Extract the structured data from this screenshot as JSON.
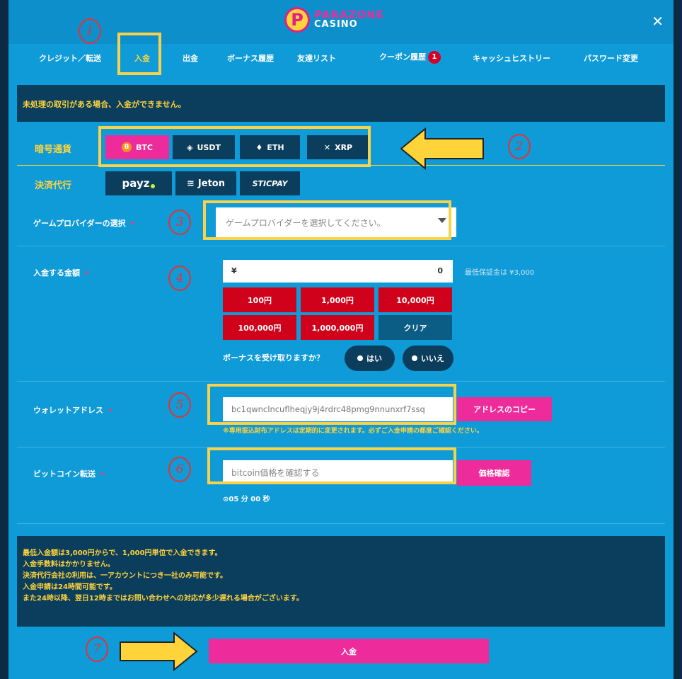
{
  "logo": {
    "line1": "PARAZONE",
    "line2": "CASINO"
  },
  "close": "✕",
  "tabs": [
    {
      "label": "クレジット／転送"
    },
    {
      "label": "入金"
    },
    {
      "label": "出金"
    },
    {
      "label": "ボーナス履歴"
    },
    {
      "label": "友達リスト"
    },
    {
      "label": "クーポン履歴",
      "badge": "1"
    },
    {
      "label": "キャッシュヒストリー"
    },
    {
      "label": "パスワード変更"
    }
  ],
  "notice": "未処理の取引がある場合、入金ができません。",
  "crypto": {
    "label": "暗号通貨",
    "coins": [
      {
        "label": "BTC",
        "icon": "bitcoin-icon"
      },
      {
        "label": "USDT",
        "icon": "tether-icon"
      },
      {
        "label": "ETH",
        "icon": "ethereum-icon"
      },
      {
        "label": "XRP",
        "icon": "xrp-icon"
      }
    ]
  },
  "payment_agent": {
    "label": "決済代行",
    "options": [
      "payz",
      "Jeton",
      "STICPAY"
    ]
  },
  "provider": {
    "label": "ゲームプロバイダーの選択",
    "placeholder": "ゲームプロバイダーを選択してください。"
  },
  "amount": {
    "label": "入金する金額",
    "currency": "¥",
    "value": "0",
    "min_note": "最低保証金は ¥3,000",
    "buttons": [
      "100円",
      "1,000円",
      "10,000円",
      "100,000円",
      "1,000,000円",
      "クリア"
    ]
  },
  "bonus": {
    "question": "ボーナスを受け取りますか？",
    "yes": "はい",
    "no": "いいえ"
  },
  "wallet": {
    "label": "ウォレットアドレス",
    "value": "bc1qwnclncuflheqjy9j4rdrc48pmg9nnunxrf7ssq",
    "copy_button": "アドレスのコピー",
    "note": "※専用振込財布アドレスは定期的に変更されます。必ずご入金申請の都度ご確認ください。"
  },
  "bitcoin": {
    "label": "ビットコイン転送",
    "placeholder": "bitcoin価格を確認する",
    "check_button": "価格確認",
    "timer": "05 分 00 秒"
  },
  "info_lines": [
    "最低入金額は3,000円からで、1,000円単位で入金できます。",
    "入金手数料はかかりません。",
    "決済代行会社の利用は、一アカウントにつき一社のみ可能です。",
    "入金申請は24時間可能です。",
    "また24時以降、翌日12時まではお問い合わせへの対応が多少遅れる場合がございます。"
  ],
  "submit": "入金",
  "annotations": [
    "1",
    "2",
    "3",
    "4",
    "5",
    "6",
    "7"
  ],
  "colors": {
    "panel": "#0f9ad8",
    "dark": "#0b3d5c",
    "accent_pink": "#ee2b9a",
    "accent_yellow": "#ffd43b",
    "amount_red": "#d0021b",
    "highlight": "#f7d24a",
    "annotation_red": "#e63232"
  }
}
